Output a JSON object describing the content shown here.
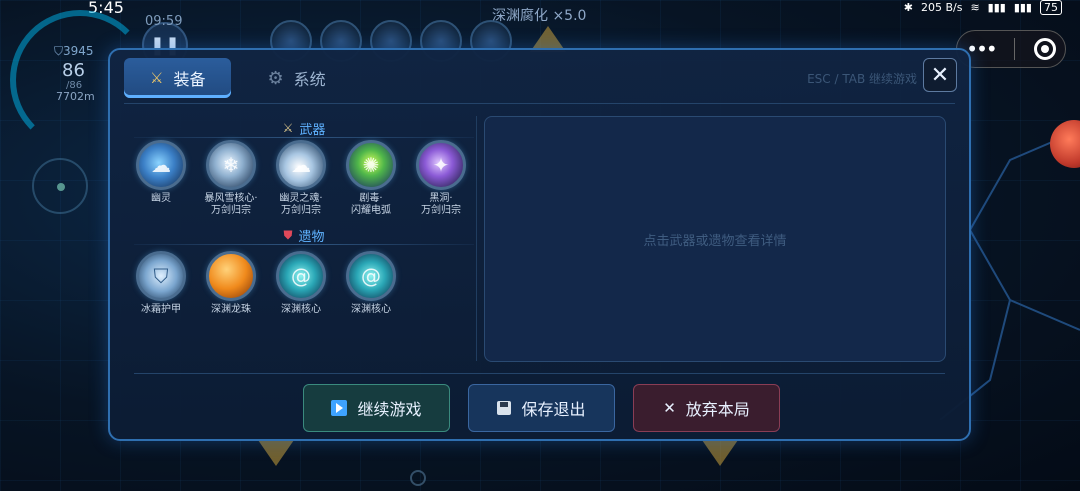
{
  "status_bar": {
    "time": "5:45",
    "net_speed": "205 B/s",
    "battery": "75"
  },
  "hud": {
    "game_title": "深渊腐化 ×5.0",
    "timer": "09:59",
    "shield": "3945",
    "level": "86",
    "level_sub": "/86",
    "distance": "7702m"
  },
  "panel": {
    "tabs": [
      {
        "label": "装备",
        "icon": "crossed-swords-icon",
        "active": true
      },
      {
        "label": "系统",
        "icon": "gear-icon",
        "active": false
      }
    ],
    "hint": "ESC / TAB 继续游戏",
    "close_label": "✕",
    "weapons": {
      "heading": "武器",
      "items": [
        {
          "name": "幽灵",
          "icon": "ghost-icon"
        },
        {
          "name": "暴风雪核心·\n万剑归宗",
          "icon": "blizzard-core-icon"
        },
        {
          "name": "幽灵之魂·\n万剑归宗",
          "icon": "ghost-soul-icon"
        },
        {
          "name": "剧毒·\n闪耀电弧",
          "icon": "poison-arc-icon"
        },
        {
          "name": "黑洞·\n万剑归宗",
          "icon": "black-hole-icon"
        }
      ]
    },
    "relics": {
      "heading": "遗物",
      "items": [
        {
          "name": "冰霜护甲",
          "icon": "frost-armor-icon"
        },
        {
          "name": "深渊龙珠",
          "icon": "dragon-orb-icon"
        },
        {
          "name": "深渊核心",
          "icon": "abyss-core-icon"
        },
        {
          "name": "深渊核心",
          "icon": "abyss-core-icon"
        }
      ]
    },
    "detail_hint": "点击武器或遗物查看详情",
    "buttons": {
      "continue": "继续游戏",
      "save_quit": "保存退出",
      "abandon": "放弃本局"
    }
  },
  "colors": {
    "accent": "#5fb2ff",
    "panel_border": "#2f6fb0",
    "continue": "#3a8a7e",
    "quit": "#8a3d55"
  }
}
